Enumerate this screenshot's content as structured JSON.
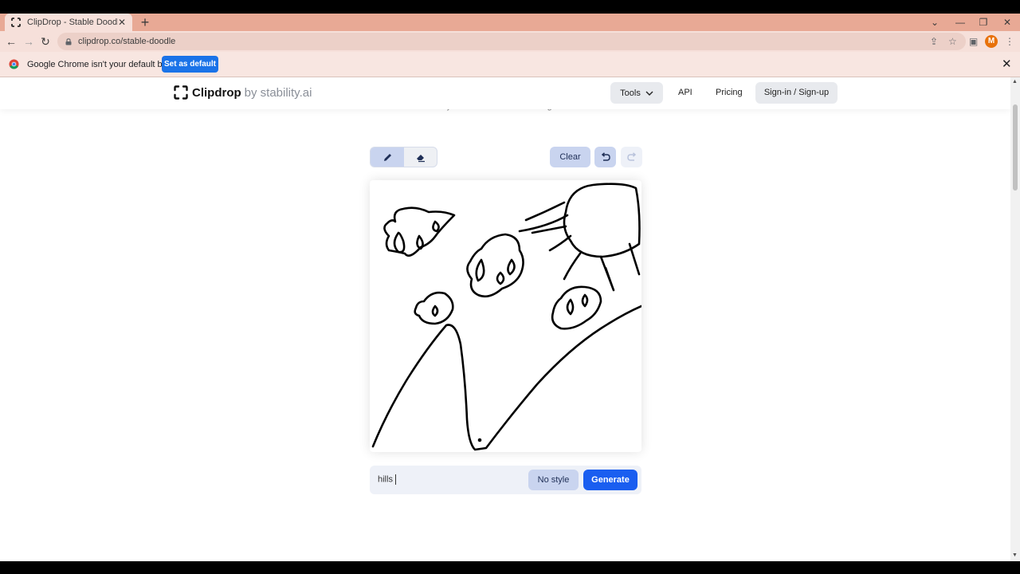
{
  "browser": {
    "tab_title": "ClipDrop - Stable Doodle",
    "tab_close": "✕",
    "new_tab": "+",
    "url": "clipdrop.co/stable-doodle",
    "avatar_letter": "M",
    "window_controls": {
      "minimize": "—",
      "restore": "❐",
      "close": "✕",
      "tab_search": "⌄"
    }
  },
  "infobar": {
    "message": "Google Chrome isn't your default browser",
    "button_label": "Set as default",
    "close": "✕"
  },
  "site": {
    "logo_name": "Clipdrop",
    "logo_by": "by stability.ai",
    "nav": {
      "tools": "Tools",
      "api": "API",
      "pricing": "Pricing",
      "signin": "Sign-in / Sign-up"
    },
    "subtitle": "Transform your doodles into real images in seconds"
  },
  "editor": {
    "clear_label": "Clear",
    "prompt_value": "hills",
    "style_label": "No style",
    "generate_label": "Generate",
    "accent_color": "#1a5ef0"
  }
}
